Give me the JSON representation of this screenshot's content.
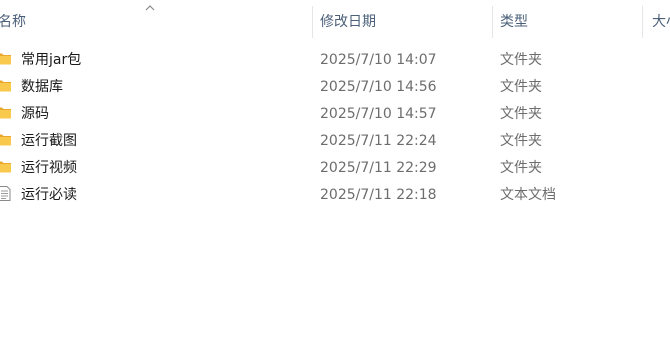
{
  "columns": {
    "name": "名称",
    "date": "修改日期",
    "type": "类型",
    "size": "大小"
  },
  "sort": {
    "column": "name",
    "direction": "ascending",
    "icon": "chevron-up-icon"
  },
  "files": [
    {
      "name": "常用jar包",
      "date": "2025/7/10 14:07",
      "type": "文件夹",
      "icon": "folder-icon"
    },
    {
      "name": "数据库",
      "date": "2025/7/10 14:56",
      "type": "文件夹",
      "icon": "folder-icon"
    },
    {
      "name": "源码",
      "date": "2025/7/10 14:57",
      "type": "文件夹",
      "icon": "folder-icon"
    },
    {
      "name": "运行截图",
      "date": "2025/7/11 22:24",
      "type": "文件夹",
      "icon": "folder-icon"
    },
    {
      "name": "运行视频",
      "date": "2025/7/11 22:29",
      "type": "文件夹",
      "icon": "folder-icon"
    },
    {
      "name": "运行必读",
      "date": "2025/7/11 22:18",
      "type": "文本文档",
      "icon": "text-document-icon"
    }
  ],
  "colors": {
    "folder": "#f8c94c",
    "header_text": "#4c607a",
    "meta_text": "#6d6d6d"
  }
}
